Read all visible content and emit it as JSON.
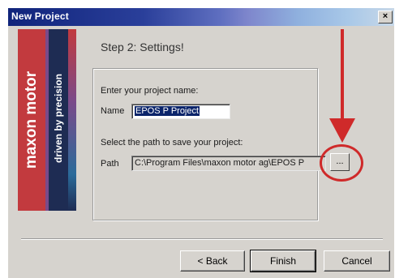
{
  "window": {
    "title": "New Project",
    "close_label": "×"
  },
  "banner": {
    "brand": "maxon motor",
    "tagline": "driven by precision"
  },
  "step": {
    "heading": "Step 2: Settings!"
  },
  "project": {
    "name_prompt": "Enter your project name:",
    "name_label": "Name",
    "name_value": "EPOS P Project"
  },
  "path": {
    "prompt": "Select the path to save your project:",
    "label": "Path",
    "value": "C:\\Program Files\\maxon motor ag\\EPOS P",
    "browse_label": "..."
  },
  "buttons": {
    "back": "< Back",
    "finish": "Finish",
    "cancel": "Cancel"
  },
  "colors": {
    "annotation": "#cf2a2a",
    "selection": "#0a246a",
    "brand_red": "#c23a3e",
    "brand_navy": "#1e2c53"
  }
}
